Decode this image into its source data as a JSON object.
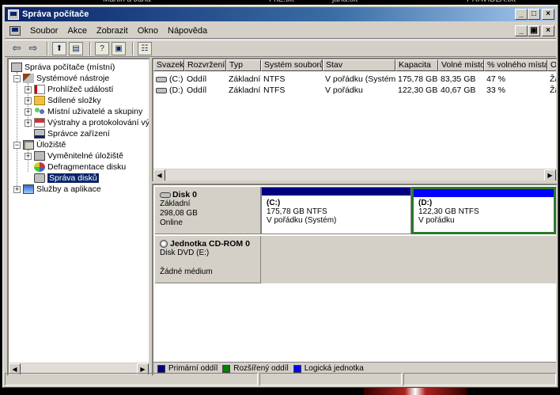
{
  "desktop": {
    "strip_texts": [
      "Martin a Jana",
      "FhE.txt",
      "jana.txt",
      "PRAVIDLA.txt"
    ]
  },
  "window": {
    "title": "Správa počítače",
    "controls": {
      "minimize": "_",
      "maximize": "□",
      "close": "×"
    }
  },
  "menubar": {
    "items": [
      "Soubor",
      "Akce",
      "Zobrazit",
      "Okno",
      "Nápověda"
    ],
    "mdi_controls": {
      "minimize": "_",
      "restore": "▣",
      "close": "×"
    }
  },
  "toolbar": {
    "icons": [
      "back-arrow-icon",
      "forward-arrow-icon",
      "up-folder-icon",
      "show-tree-icon",
      "help-icon",
      "console-icon",
      "properties-icon"
    ]
  },
  "tree": {
    "items": [
      {
        "label": "Správa počítače (místní)",
        "icon": "computer-icon",
        "level": 0,
        "expander": ""
      },
      {
        "label": "Systémové nástroje",
        "icon": "tools-icon",
        "level": 1,
        "expander": "−"
      },
      {
        "label": "Prohlížeč událostí",
        "icon": "event-viewer-icon",
        "level": 2,
        "expander": "+"
      },
      {
        "label": "Sdílené složky",
        "icon": "shared-folder-icon",
        "level": 2,
        "expander": "+"
      },
      {
        "label": "Místní uživatelé a skupiny",
        "icon": "users-icon",
        "level": 2,
        "expander": "+"
      },
      {
        "label": "Výstrahy a protokolování vý",
        "icon": "alerts-icon",
        "level": 2,
        "expander": "+"
      },
      {
        "label": "Správce zařízení",
        "icon": "device-manager-icon",
        "level": 2,
        "expander": ""
      },
      {
        "label": "Úložiště",
        "icon": "storage-icon",
        "level": 1,
        "expander": "−"
      },
      {
        "label": "Vyměnitelné úložiště",
        "icon": "removable-storage-icon",
        "level": 2,
        "expander": "+"
      },
      {
        "label": "Defragmentace disku",
        "icon": "defrag-icon",
        "level": 2,
        "expander": ""
      },
      {
        "label": "Správa disků",
        "icon": "disk-management-icon",
        "level": 2,
        "expander": "",
        "selected": true
      },
      {
        "label": "Služby a aplikace",
        "icon": "services-icon",
        "level": 1,
        "expander": "+"
      }
    ]
  },
  "volume_list": {
    "columns": [
      "Svazek",
      "Rozvržení",
      "Typ",
      "Systém souborů",
      "Stav",
      "Kapacita",
      "Volné místo",
      "% volného místa",
      "Od"
    ],
    "rows": [
      [
        "(C:)",
        "Oddíl",
        "Základní",
        "NTFS",
        "V pořádku (Systém)",
        "175,78 GB",
        "83,35 GB",
        "47 %",
        "Žá"
      ],
      [
        "(D:)",
        "Oddíl",
        "Základní",
        "NTFS",
        "V pořádku",
        "122,30 GB",
        "40,67 GB",
        "33 %",
        "Žá"
      ]
    ]
  },
  "disks": [
    {
      "name": "Disk 0",
      "lines": [
        "Základní",
        "298,08 GB",
        "Online"
      ],
      "partitions": [
        {
          "name": "(C:)",
          "size": "175,78 GB NTFS",
          "status": "V pořádku (Systém)",
          "color": "#000080"
        },
        {
          "name": "(D:)",
          "size": "122,30 GB NTFS",
          "status": "V pořádku",
          "color": "#0000ff"
        }
      ]
    },
    {
      "name": "Jednotka CD-ROM 0",
      "lines": [
        "Disk DVD (E:)",
        "",
        "Žádné médium"
      ]
    }
  ],
  "legend": [
    {
      "label": "Primární oddíl",
      "color": "#000080"
    },
    {
      "label": "Rozšířený oddíl",
      "color": "#008000"
    },
    {
      "label": "Logická jednotka",
      "color": "#0000ff"
    }
  ]
}
